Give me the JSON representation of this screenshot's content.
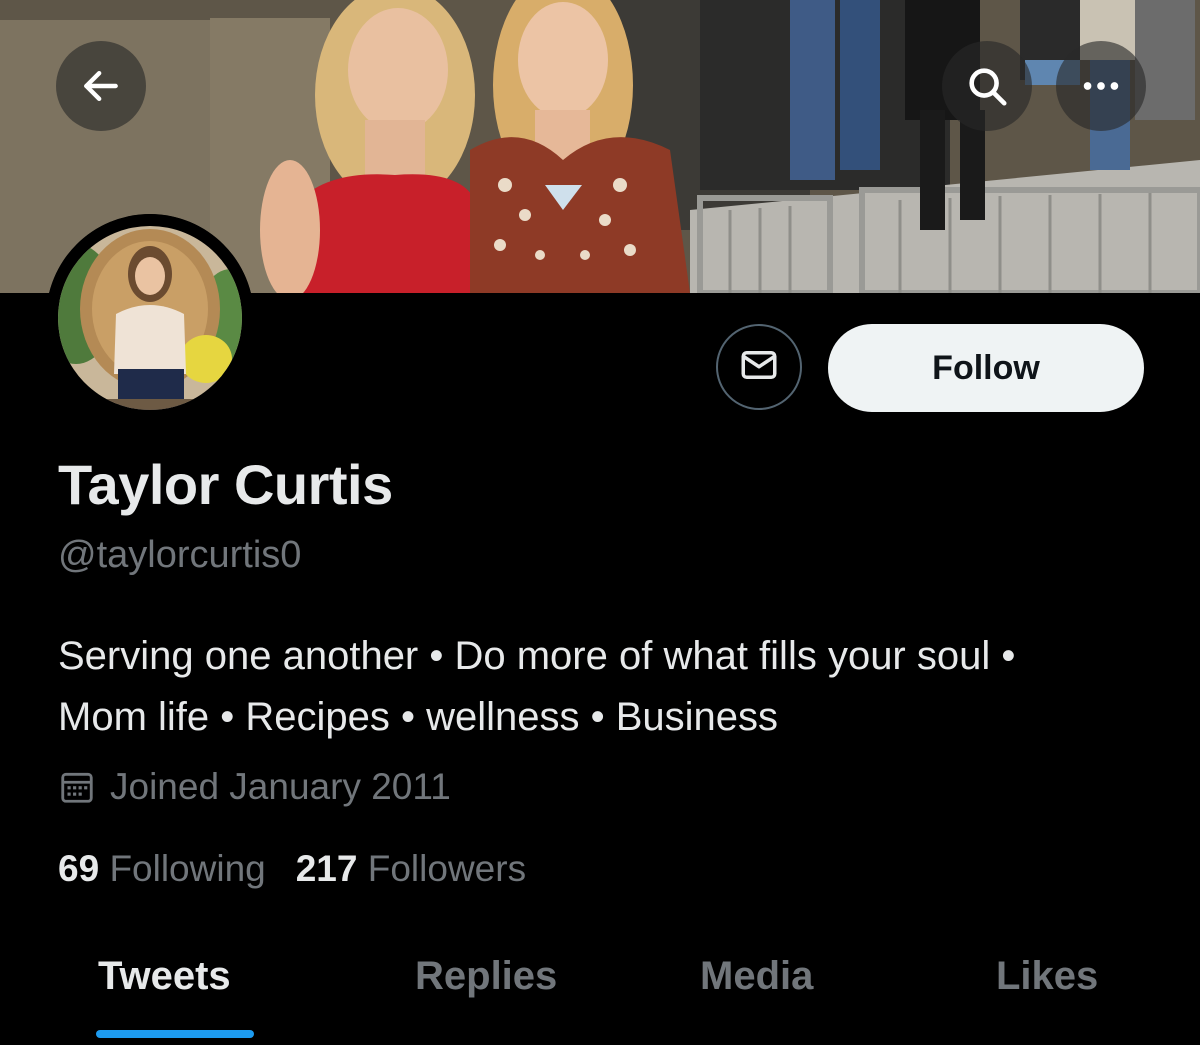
{
  "header": {
    "back_icon": "arrow-left-icon",
    "search_icon": "search-icon",
    "more_icon": "more-horizontal-icon"
  },
  "profile": {
    "display_name": "Taylor Curtis",
    "handle": "@taylorcurtis0",
    "bio_line1": "Serving one another • Do more of what fills your soul •",
    "bio_line2": "Mom life • Recipes • wellness • Business",
    "joined": "Joined January 2011",
    "following_count": "69",
    "following_label": "Following",
    "followers_count": "217",
    "followers_label": "Followers"
  },
  "actions": {
    "message_icon": "mail-icon",
    "follow_label": "Follow"
  },
  "tabs": [
    {
      "label": "Tweets",
      "active": true
    },
    {
      "label": "Replies",
      "active": false
    },
    {
      "label": "Media",
      "active": false
    },
    {
      "label": "Likes",
      "active": false
    }
  ],
  "colors": {
    "background": "#000000",
    "primary_text": "#e7e9ea",
    "secondary_text": "#71767b",
    "accent": "#1d9bf0",
    "follow_button_bg": "#eff3f4"
  }
}
